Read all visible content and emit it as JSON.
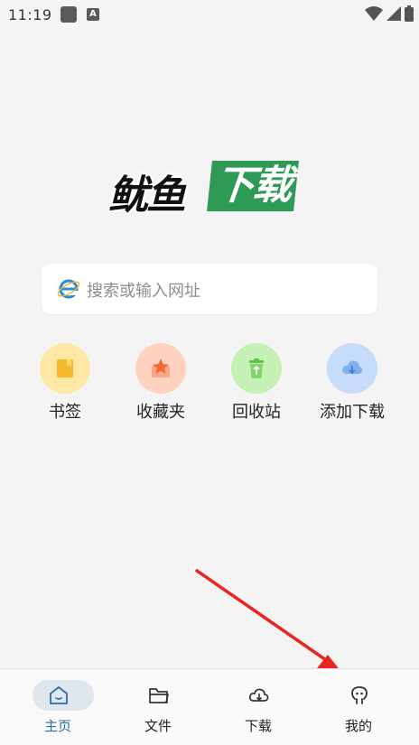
{
  "status": {
    "time": "11:19"
  },
  "logo": {
    "left": "鱿鱼",
    "right": "下载"
  },
  "search": {
    "placeholder": "搜索或输入网址"
  },
  "shortcuts": [
    {
      "label": "书签",
      "icon": "bookmark-icon",
      "bg": "#ffe8a6",
      "fg": "#f5b82e"
    },
    {
      "label": "收藏夹",
      "icon": "favorites-star-icon",
      "bg": "#ffd2bf",
      "fg": "#f2663a"
    },
    {
      "label": "回收站",
      "icon": "recycle-bin-icon",
      "bg": "#c5f2b4",
      "fg": "#5dc14a"
    },
    {
      "label": "添加下载",
      "icon": "cloud-download-icon",
      "bg": "#c7dcfb",
      "fg": "#7fb2ec"
    }
  ],
  "nav": {
    "items": [
      {
        "label": "主页",
        "icon": "home-icon",
        "active": true
      },
      {
        "label": "文件",
        "icon": "folder-icon",
        "active": false
      },
      {
        "label": "下载",
        "icon": "cloud-download-icon",
        "active": false
      },
      {
        "label": "我的",
        "icon": "profile-icon",
        "active": false
      }
    ]
  },
  "colors": {
    "accent": "#2b6ea8",
    "brand_green": "#2f9a55",
    "annotation_arrow": "#e8261f"
  }
}
